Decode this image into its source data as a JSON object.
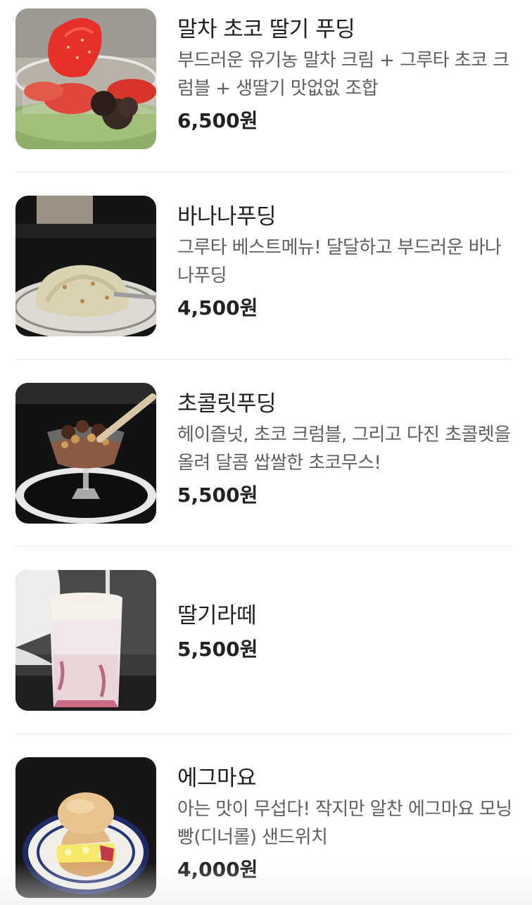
{
  "menu": {
    "items": [
      {
        "name": "말차 초코 딸기 푸딩",
        "description": "부드러운 유기농 말차 크림 + 그루타 초코 크럼블 + 생딸기 맛없없 조합",
        "price": "6,500원"
      },
      {
        "name": "바나나푸딩",
        "description": "그루타 베스트메뉴! 달달하고 부드러운 바나나푸딩",
        "price": "4,500원"
      },
      {
        "name": "초콜릿푸딩",
        "description": "헤이즐넛, 초코 크럼블, 그리고 다진 초콜렛을 올려 달콤 쌉쌀한 초코무스!",
        "price": "5,500원"
      },
      {
        "name": "딸기라떼",
        "price": "5,500원"
      },
      {
        "name": "에그마요",
        "description": "아는 맛이 무섭다! 작지만 알찬 에그마요 모닝빵(디너롤) 샌드위치",
        "price": "4,000원"
      }
    ]
  }
}
